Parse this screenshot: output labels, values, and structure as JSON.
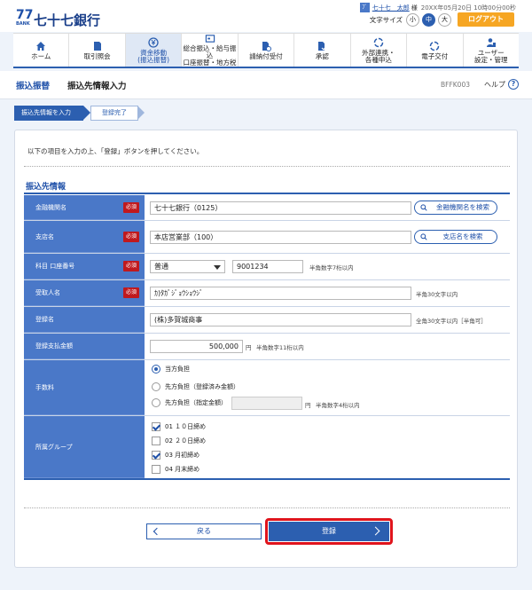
{
  "header": {
    "logo_mark": "77",
    "logo_bank": "BANK",
    "logo_text": "七十七銀行",
    "user_icon": "ﾌﾞ",
    "user_name": "七十七　太郎",
    "user_suffix": "様",
    "login_time": "20XX年05月20日 10時00分00秒",
    "font_size_label": "文字サイズ",
    "font_sizes": [
      "小",
      "中",
      "大"
    ],
    "font_size_active": "中",
    "logout_label": "ログアウト"
  },
  "nav": {
    "items": [
      {
        "label": "ホーム",
        "icon": "home-icon"
      },
      {
        "label": "取引照会",
        "icon": "document-icon"
      },
      {
        "label": "資金移動\n(振込振替)",
        "icon": "money-transfer-icon",
        "active": true
      },
      {
        "label": "総合振込・給与振込\n口座振替・地方税",
        "icon": "bulk-transfer-icon"
      },
      {
        "label": "請納付受付",
        "icon": "payment-icon"
      },
      {
        "label": "承認",
        "icon": "approval-icon"
      },
      {
        "label": "外部連携・\n各種申込",
        "icon": "link-icon"
      },
      {
        "label": "電子交付",
        "icon": "electronic-icon"
      },
      {
        "label": "ユーザー\n設定・管理",
        "icon": "user-settings-icon"
      }
    ]
  },
  "title_bar": {
    "main": "振込振替",
    "sub": "振込先情報入力",
    "screen_id": "BFFK003",
    "help_label": "ヘルプ",
    "help_icon": "?"
  },
  "steps": {
    "current": "振込先情報を入力",
    "next": "登録完了"
  },
  "content": {
    "instruction": "以下の項目を入力の上、「登録」ボタンを押してください。",
    "section_title": "振込先情報",
    "required_label": "必須",
    "fields": {
      "bank": {
        "label": "金融機関名",
        "value": "七十七銀行（0125）",
        "button": "金融機関名を検索"
      },
      "branch": {
        "label": "支店名",
        "value": "本店営業部（100）",
        "button": "支店名を検索"
      },
      "account": {
        "label": "科目 口座番号",
        "type_value": "普通",
        "number_value": "9001234",
        "hint": "半角数字7桁以内"
      },
      "recipient": {
        "label": "受取人名",
        "value": "ｶ)ﾀｶﾞｼﾞｮｳｼｮｳｼﾞ",
        "hint": "半角30文字以内"
      },
      "registered_name": {
        "label": "登録名",
        "value": "(株)多賀城商事",
        "hint": "全角30文字以内［半角可］"
      },
      "amount": {
        "label": "登録支払金額",
        "value": "500,000",
        "unit": "円",
        "hint": "半角数字11桁以内"
      },
      "fee": {
        "label": "手数料",
        "options": [
          "当方負担",
          "先方負担（登録済み金額）",
          "先方負担（指定金額）"
        ],
        "selected_index": 0,
        "specified_amount": "",
        "specified_unit": "円",
        "specified_hint": "半角数字4桁以内"
      },
      "group": {
        "label": "所属グループ",
        "options": [
          {
            "label": "01 １０日締め",
            "checked": true
          },
          {
            "label": "02 ２０日締め",
            "checked": false
          },
          {
            "label": "03 月初締め",
            "checked": true
          },
          {
            "label": "04 月末締め",
            "checked": false
          }
        ]
      }
    }
  },
  "buttons": {
    "back": "戻る",
    "register": "登録"
  },
  "colors": {
    "primary": "#2c5fb0",
    "label_bg": "#4a78c8",
    "required": "#c0191e",
    "logout": "#f6a623",
    "highlight": "#e0141c"
  }
}
